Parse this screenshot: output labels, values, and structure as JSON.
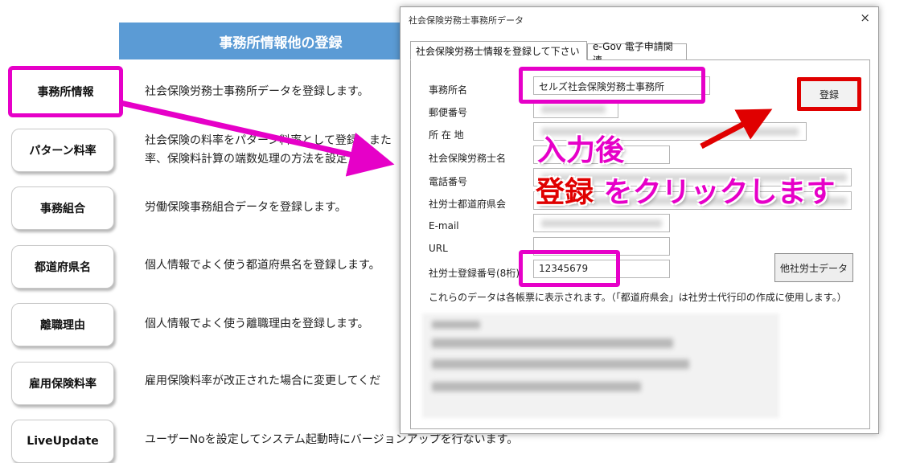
{
  "page": {
    "banner_title": "事務所情報他の登録",
    "menu": [
      {
        "label": "事務所情報",
        "desc": "社会保険労務士事務所データを登録します。"
      },
      {
        "label": "パターン料率",
        "desc_line1": "社会保険の料率をパターン料率として登録、また",
        "desc_line2": "率、保険料計算の端数処理の方法を設定します。"
      },
      {
        "label": "事務組合",
        "desc": "労働保険事務組合データを登録します。"
      },
      {
        "label": "都道府県名",
        "desc": "個人情報でよく使う都道府県名を登録します。"
      },
      {
        "label": "離職理由",
        "desc": "個人情報でよく使う離職理由を登録します。"
      },
      {
        "label": "雇用保険料率",
        "desc": "雇用保険料率が改正された場合に変更してくだ"
      },
      {
        "label": "LiveUpdate",
        "desc": "ユーザーNoを設定してシステム起動時にバージョンアップを行ないます。"
      }
    ]
  },
  "dialog": {
    "title": "社会保険労務士事務所データ",
    "close_glyph": "×",
    "tabs": [
      "社会保険労務士情報を登録して下さい",
      "e-Gov 電子申請関連"
    ],
    "fields": {
      "office_name_label": "事務所名",
      "office_name_value": "セルズ社会保険労務士事務所",
      "postal_label": "郵便番号",
      "address_label": "所 在 地",
      "sharoushi_name_label": "社会保険労務士名",
      "phone_label": "電話番号",
      "prefecture_assoc_label": "社労士都道府県会",
      "email_label": "E-mail",
      "url_label": "URL",
      "reg_number_label": "社労士登録番号(8桁)",
      "reg_number_value": "12345679"
    },
    "register_button": "登録",
    "other_data_button": "他社労士データ",
    "note": "これらのデータは各帳票に表示されます。（「都道府県会」は社労士代行印の作成に使用します。）"
  },
  "annotation": {
    "line1": "入力後",
    "line2_red": "登録",
    "line2_rest": " をクリックします"
  },
  "colors": {
    "highlight": "#e600c8",
    "register_border": "#e00000",
    "banner": "#5b9bd5"
  }
}
